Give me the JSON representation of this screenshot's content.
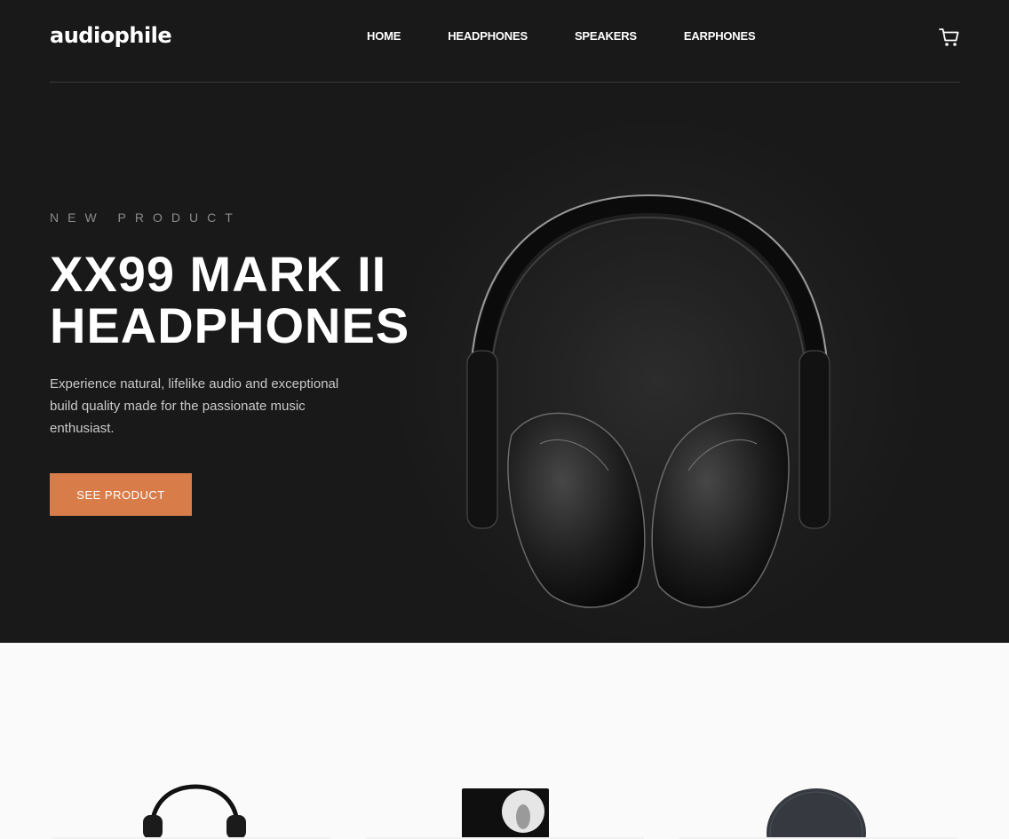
{
  "brand": {
    "logo": "audiophile",
    "accent": "#D87D4A"
  },
  "nav": {
    "items": [
      {
        "label": "HOME"
      },
      {
        "label": "HEADPHONES"
      },
      {
        "label": "SPEAKERS"
      },
      {
        "label": "EARPHONES"
      }
    ]
  },
  "cart": {
    "icon": "cart-icon"
  },
  "hero": {
    "overline": "NEW PRODUCT",
    "title": "XX99 MARK II HEADPHONES",
    "description": "Experience natural, lifelike audio and exceptional build quality made for the passionate music enthusiast.",
    "cta": "SEE PRODUCT"
  },
  "categories": [
    {
      "image": "headphones-image"
    },
    {
      "image": "speaker-image"
    },
    {
      "image": "earphones-image"
    }
  ]
}
